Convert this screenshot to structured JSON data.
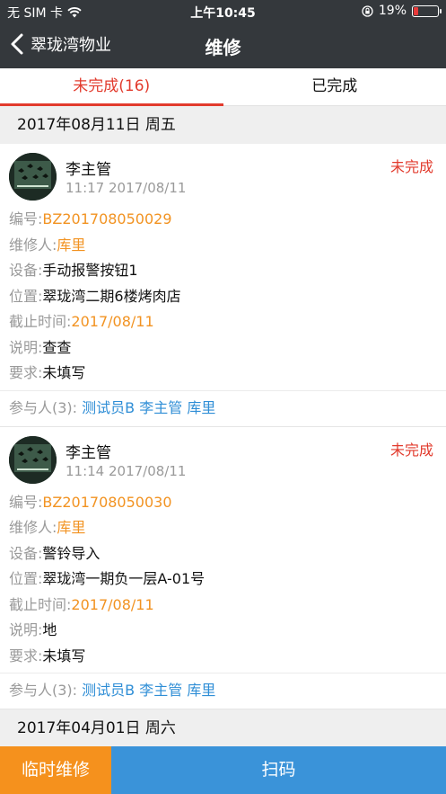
{
  "status_bar": {
    "carrier": "无 SIM 卡",
    "time": "上午10:45",
    "battery": "19%",
    "battery_level": 0.19
  },
  "nav": {
    "back_label": "翠珑湾物业",
    "title": "维修"
  },
  "tabs": [
    {
      "label": "未完成(16)",
      "active": true
    },
    {
      "label": "已完成",
      "active": false
    }
  ],
  "groups": [
    {
      "date": "2017年08月11日  周五",
      "cards": [
        {
          "name": "李主管",
          "time": "11:17 2017/08/11",
          "status": "未完成",
          "fields": {
            "id_label": "编号:",
            "id_value": "BZ201708050029",
            "repairer_label": "维修人:",
            "repairer_value": "库里",
            "device_label": "设备:",
            "device_value": "手动报警按钮1",
            "location_label": "位置:",
            "location_value": "翠珑湾二期6楼烤肉店",
            "deadline_label": "截止时间:",
            "deadline_value": "2017/08/11",
            "desc_label": "说明:",
            "desc_value": "查查",
            "req_label": "要求:",
            "req_value": "未填写"
          },
          "participants_label": "参与人(3):",
          "participants": [
            "测试员B",
            "李主管",
            "库里"
          ]
        },
        {
          "name": "李主管",
          "time": "11:14 2017/08/11",
          "status": "未完成",
          "fields": {
            "id_label": "编号:",
            "id_value": "BZ201708050030",
            "repairer_label": "维修人:",
            "repairer_value": "库里",
            "device_label": "设备:",
            "device_value": "警铃导入",
            "location_label": "位置:",
            "location_value": "翠珑湾一期负一层A-01号",
            "deadline_label": "截止时间:",
            "deadline_value": "2017/08/11",
            "desc_label": "说明:",
            "desc_value": "地",
            "req_label": "要求:",
            "req_value": "未填写"
          },
          "participants_label": "参与人(3):",
          "participants": [
            "测试员B",
            "李主管",
            "库里"
          ]
        }
      ]
    },
    {
      "date": "2017年04月01日  周六",
      "cards": []
    }
  ],
  "bottom_bar": {
    "temp_repair": "临时维修",
    "scan": "扫码"
  },
  "colors": {
    "nav_bg": "#34383c",
    "accent_red": "#e23b2d",
    "orange": "#f29322",
    "link_blue": "#2f8ed6",
    "scan_blue": "#3a93d9"
  }
}
